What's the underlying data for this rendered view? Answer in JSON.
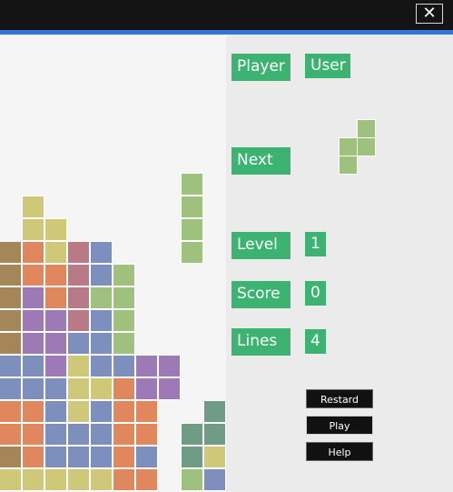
{
  "window": {
    "close_glyph": "✕"
  },
  "panel": {
    "player_label": "Player",
    "player_value": "User",
    "next_label": "Next",
    "level_label": "Level",
    "level_value": "1",
    "score_label": "Score",
    "score_value": "0",
    "lines_label": "Lines",
    "lines_value": "4"
  },
  "buttons": {
    "restart": "Restard",
    "play": "Play",
    "help": "Help"
  },
  "colors": {
    "Y": "#cfc878",
    "O": "#e0875e",
    "B": "#7d90bd",
    "R": "#b97a88",
    "P": "#9d7ab6",
    "G": "#9ec27e",
    "T": "#6f9c85",
    "K": "#a58658",
    "label_bg": "#3cb371"
  },
  "board": {
    "rows": [
      "..........",
      "..........",
      "..........",
      "..........",
      "..........",
      "..........",
      "..........",
      "........G.",
      ".Y......G.",
      ".YY.....G.",
      "KOYRB...G.",
      "KOORBG....",
      "KPORGG....",
      "KPPRBG....",
      "KPPBBG....",
      "BBPYBBPP..",
      "BBBYYOPP..",
      "OOBYBOO..T",
      "OOBBBOO.TT",
      "KOBBBOB.TY",
      "YYYYYOO.GB"
    ]
  },
  "next_piece": {
    "color": "G",
    "cells": [
      [
        1,
        0
      ],
      [
        0,
        1
      ],
      [
        1,
        1
      ],
      [
        0,
        2
      ]
    ]
  }
}
